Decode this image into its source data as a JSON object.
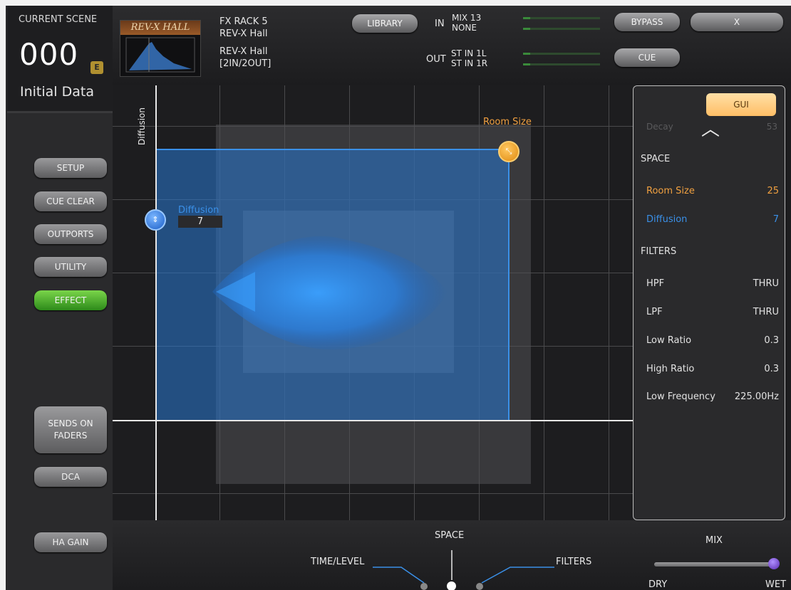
{
  "scene": {
    "label": "CURRENT SCENE",
    "number": "000",
    "badge": "E",
    "name": "Initial Data"
  },
  "sidebar": {
    "buttons": [
      {
        "label": "SETUP"
      },
      {
        "label": "CUE CLEAR"
      },
      {
        "label": "OUTPORTS"
      },
      {
        "label": "UTILITY"
      },
      {
        "label": "EFFECT"
      },
      {
        "label": "SENDS ON\nFADERS"
      },
      {
        "label": "DCA"
      },
      {
        "label": "HA GAIN"
      }
    ]
  },
  "header": {
    "thumb_title": "REV-X HALL",
    "fx_rack": "FX RACK 5",
    "fx_type": "REV-X Hall",
    "fx_name": "REV-X Hall",
    "fx_io": "[2IN/2OUT]",
    "library_label": "LIBRARY",
    "in_label": "IN",
    "in_src1": "MIX 13",
    "in_src2": "NONE",
    "out_label": "OUT",
    "out_dst1": "ST IN 1L",
    "out_dst2": "ST IN 1R",
    "bypass_label": "BYPASS",
    "close_label": "X",
    "cue_label": "CUE"
  },
  "graph": {
    "y_axis_label": "Diffusion",
    "room_size_label": "Room Size",
    "diffusion_label": "Diffusion",
    "diffusion_value": "7"
  },
  "panel": {
    "gui_label": "GUI",
    "decay_label": "Decay",
    "decay_value": "53",
    "space_heading": "SPACE",
    "room_size_label": "Room Size",
    "room_size_value": "25",
    "diffusion_label": "Diffusion",
    "diffusion_value": "7",
    "filters_heading": "FILTERS",
    "hpf_label": "HPF",
    "hpf_value": "THRU",
    "lpf_label": "LPF",
    "lpf_value": "THRU",
    "low_ratio_label": "Low Ratio",
    "low_ratio_value": "0.3",
    "high_ratio_label": "High Ratio",
    "high_ratio_value": "0.3",
    "low_freq_label": "Low Frequency",
    "low_freq_value": "225.00Hz",
    "room_color": "#f0a040",
    "diffusion_color": "#3a90e8"
  },
  "bottom": {
    "space_label": "SPACE",
    "time_level_label": "TIME/LEVEL",
    "filters_label": "FILTERS",
    "mix_label": "MIX",
    "dry_label": "DRY",
    "wet_label": "WET",
    "mix_value_fraction": 1.0
  }
}
